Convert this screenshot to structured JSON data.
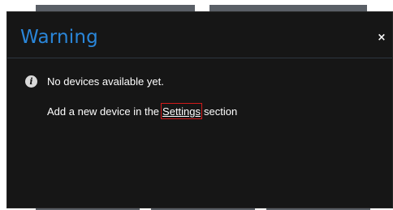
{
  "dialog": {
    "title": "Warning",
    "close_label": "×",
    "message": "No devices available yet.",
    "hint_prefix": "Add a new device in the",
    "hint_link": "Settings",
    "hint_suffix": "section",
    "info_icon_glyph": "i"
  },
  "colors": {
    "title": "#2a86d9",
    "dialog_bg": "#161616",
    "link_highlight": "#d11a1a"
  },
  "icons": {
    "info": "info-icon",
    "close": "close-icon"
  }
}
